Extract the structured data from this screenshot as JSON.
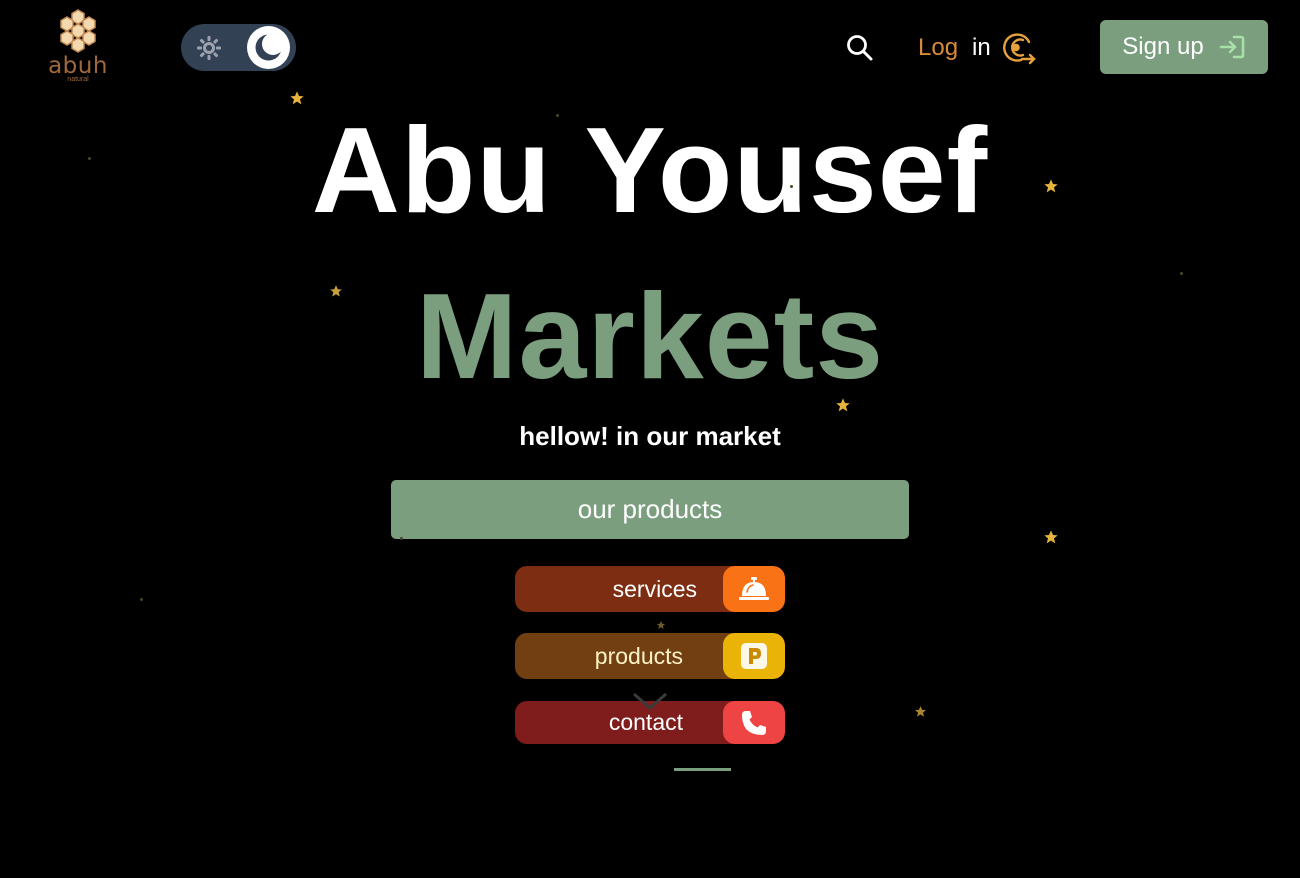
{
  "logo": {
    "word": "abuh",
    "sub": "natural",
    "icon": "honeycomb-icon",
    "color": "#a0693c"
  },
  "theme_toggle": {
    "light_icon": "sun-icon",
    "dark_icon": "moon-icon",
    "state": "dark"
  },
  "header": {
    "search_icon": "search-icon",
    "login_part1": "Log",
    "login_part2": "in",
    "login_icon": "target-arrow-icon",
    "signup_label": "Sign up",
    "signup_icon": "sign-in-icon"
  },
  "hero": {
    "title": "Abu Yousef",
    "subtitle": "Markets",
    "tagline": "hellow! in our market",
    "cta_label": "our products"
  },
  "menu": {
    "items": [
      {
        "label": "services",
        "icon": "service-bell-icon",
        "color": "#f97316"
      },
      {
        "label": "products",
        "icon": "parking-p-icon",
        "color": "#eab308"
      },
      {
        "label": "contact",
        "icon": "phone-icon",
        "color": "#ef4444"
      }
    ]
  },
  "colors": {
    "accent": "#7b9e7f",
    "background": "#000000",
    "star": "#e6b43c"
  }
}
